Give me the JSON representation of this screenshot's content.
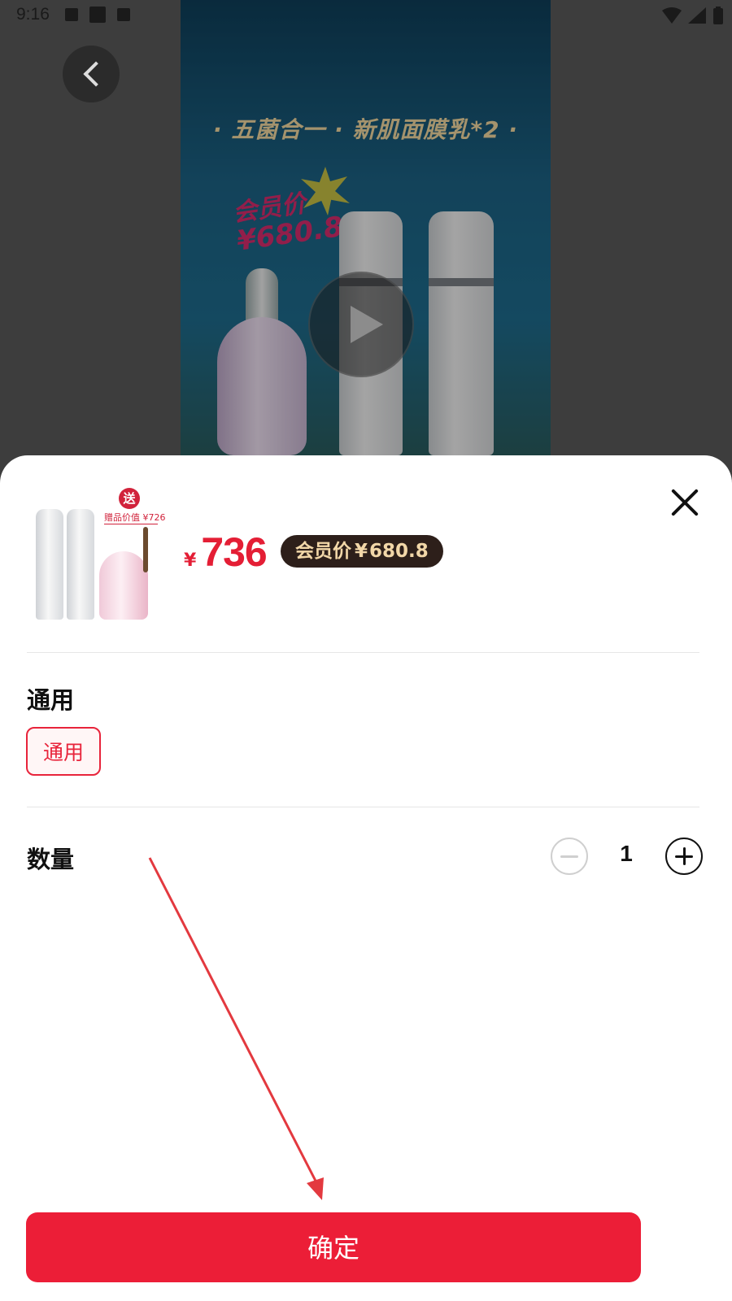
{
  "status_bar": {
    "time": "9:16"
  },
  "video": {
    "banner_text": "· 五菌合一 · 新肌面膜乳*2 ·",
    "member_sticker_line1": "会员价",
    "member_sticker_line2": "¥680.8"
  },
  "sheet": {
    "thumbnail": {
      "gift_badge": "送",
      "gift_value_text": "赠品价值 ¥726"
    },
    "price_symbol": "¥",
    "price": "736",
    "member_price_label": "会员价",
    "member_price_symbol": "¥",
    "member_price_value": "680.8",
    "spec_section_title": "通用",
    "spec_options": [
      "通用"
    ],
    "quantity_title": "数量",
    "quantity_value": "1",
    "confirm_label": "确定"
  },
  "colors": {
    "accent": "#ec1e37",
    "member_badge_bg": "#2d1f1a",
    "member_badge_text": "#f2d7a8"
  }
}
